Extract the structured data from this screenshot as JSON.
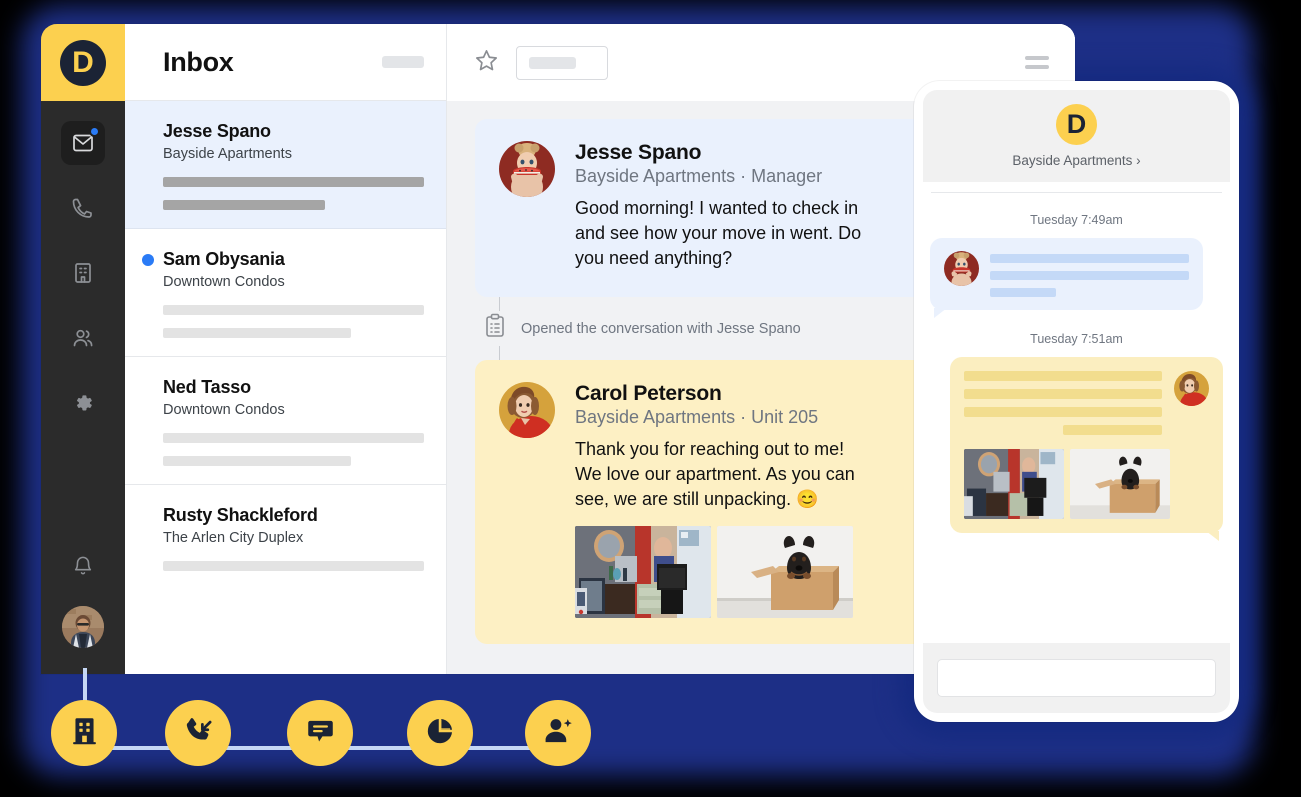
{
  "brand": {
    "logo_letter": "D",
    "accent_yellow": "#fcd04f",
    "accent_blue": "#2a7bf6",
    "dark": "#1b2335",
    "glow": "#1d2f86"
  },
  "sidebar": {
    "items": [
      {
        "icon": "inbox-icon",
        "label": "Inbox",
        "active": true,
        "badge": true
      },
      {
        "icon": "phone-icon",
        "label": "Calls",
        "active": false,
        "badge": false
      },
      {
        "icon": "building-icon",
        "label": "Properties",
        "active": false,
        "badge": false
      },
      {
        "icon": "people-icon",
        "label": "Contacts",
        "active": false,
        "badge": false
      },
      {
        "icon": "gear-icon",
        "label": "Settings",
        "active": false,
        "badge": false
      }
    ],
    "bell": {
      "icon": "bell-icon",
      "label": "Notifications"
    },
    "avatar": {
      "icon": "user-avatar",
      "label": "Account"
    }
  },
  "list_panel": {
    "title": "Inbox",
    "header_placeholder": "",
    "conversations": [
      {
        "name": "Jesse Spano",
        "property": "Bayside Apartments",
        "selected": true,
        "unread": false,
        "preview_lines": [
          100,
          62
        ]
      },
      {
        "name": "Sam Obysania",
        "property": "Downtown Condos",
        "selected": false,
        "unread": true,
        "preview_lines": [
          100,
          72
        ]
      },
      {
        "name": "Ned Tasso",
        "property": "Downtown Condos",
        "selected": false,
        "unread": false,
        "preview_lines": [
          100,
          72
        ]
      },
      {
        "name": "Rusty Shackleford",
        "property": "The Arlen City Duplex",
        "selected": false,
        "unread": false,
        "preview_lines": [
          100
        ]
      }
    ]
  },
  "thread_panel": {
    "toolbar": {
      "star_icon": "star-icon",
      "search_placeholder": "",
      "menu_icon": "hamburger-icon"
    },
    "messages": [
      {
        "kind": "inbound",
        "author": "Jesse Spano",
        "meta": "Bayside Apartments · Manager",
        "body": "Good morning! I wanted to check in and see how your move in went. Do you need anything?",
        "avatar": "jesse-avatar",
        "photos": []
      },
      {
        "kind": "outbound",
        "author": "Carol Peterson",
        "meta": "Bayside Apartments · Unit 205",
        "body": "Thank you for reaching out to me! We love our apartment. As you can see, we are still unpacking. 😊",
        "avatar": "carol-avatar",
        "photos": [
          "moving-boxes-photo",
          "dog-in-box-photo"
        ]
      }
    ],
    "event": {
      "icon": "clipboard-icon",
      "text": "Opened the conversation with Jesse Spano"
    }
  },
  "phone_panel": {
    "header": {
      "logo_letter": "D",
      "org": "Bayside Apartments",
      "chevron": "chevron-right-icon"
    },
    "threads": [
      {
        "timestamp": "Tuesday 7:49am",
        "direction": "inbound",
        "avatar": "jesse-avatar",
        "line_widths": [
          100,
          100,
          33
        ]
      },
      {
        "timestamp": "Tuesday 7:51am",
        "direction": "outbound",
        "avatar": "carol-avatar",
        "line_widths": [
          100,
          100,
          100,
          50
        ],
        "photos": [
          "moving-boxes-photo",
          "dog-in-box-photo"
        ]
      }
    ],
    "composer_placeholder": ""
  },
  "feature_nodes": [
    {
      "icon": "building-icon",
      "label": "Properties"
    },
    {
      "icon": "incoming-call-icon",
      "label": "Calls"
    },
    {
      "icon": "chat-bubble-icon",
      "label": "Messaging"
    },
    {
      "icon": "pie-chart-icon",
      "label": "Reporting"
    },
    {
      "icon": "add-person-icon",
      "label": "Leads"
    }
  ]
}
